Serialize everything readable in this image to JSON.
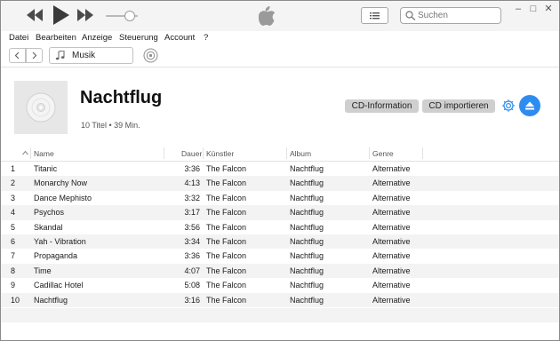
{
  "search": {
    "placeholder": "Suchen"
  },
  "menu": [
    "Datei",
    "Bearbeiten",
    "Anzeige",
    "Steuerung",
    "Account",
    "?"
  ],
  "nav": {
    "media_type": "Musik"
  },
  "album": {
    "title": "Nachtflug",
    "subtitle": "10 Titel • 39 Min.",
    "cd_info_label": "CD-Information",
    "import_label": "CD importieren"
  },
  "table": {
    "headers": {
      "name": "Name",
      "duration": "Dauer",
      "artist": "Künstler",
      "album": "Album",
      "genre": "Genre"
    },
    "rows": [
      {
        "num": "1",
        "name": "Titanic",
        "duration": "3:36",
        "artist": "The Falcon",
        "album": "Nachtflug",
        "genre": "Alternative"
      },
      {
        "num": "2",
        "name": "Monarchy Now",
        "duration": "4:13",
        "artist": "The Falcon",
        "album": "Nachtflug",
        "genre": "Alternative"
      },
      {
        "num": "3",
        "name": "Dance Mephisto",
        "duration": "3:32",
        "artist": "The Falcon",
        "album": "Nachtflug",
        "genre": "Alternative"
      },
      {
        "num": "4",
        "name": "Psychos",
        "duration": "3:17",
        "artist": "The Falcon",
        "album": "Nachtflug",
        "genre": "Alternative"
      },
      {
        "num": "5",
        "name": "Skandal",
        "duration": "3:56",
        "artist": "The Falcon",
        "album": "Nachtflug",
        "genre": "Alternative"
      },
      {
        "num": "6",
        "name": "Yah - Vibration",
        "duration": "3:34",
        "artist": "The Falcon",
        "album": "Nachtflug",
        "genre": "Alternative"
      },
      {
        "num": "7",
        "name": "Propaganda",
        "duration": "3:36",
        "artist": "The Falcon",
        "album": "Nachtflug",
        "genre": "Alternative"
      },
      {
        "num": "8",
        "name": "Time",
        "duration": "4:07",
        "artist": "The Falcon",
        "album": "Nachtflug",
        "genre": "Alternative"
      },
      {
        "num": "9",
        "name": "Cadillac Hotel",
        "duration": "5:08",
        "artist": "The Falcon",
        "album": "Nachtflug",
        "genre": "Alternative"
      },
      {
        "num": "10",
        "name": "Nachtflug",
        "duration": "3:16",
        "artist": "The Falcon",
        "album": "Nachtflug",
        "genre": "Alternative"
      }
    ]
  },
  "playback": {
    "volume_level": 0.75
  },
  "colors": {
    "accent": "#2e8cf0",
    "button_gray": "#cfcfcf",
    "row_alt": "#f3f3f3"
  },
  "icons": [
    "previous-track-icon",
    "play-icon",
    "next-track-icon",
    "apple-logo-icon",
    "list-view-icon",
    "search-icon",
    "minimize-icon",
    "maximize-icon",
    "close-icon",
    "back-arrow-icon",
    "forward-arrow-icon",
    "music-note-icon",
    "radio-icon",
    "cd-icon",
    "gear-icon",
    "eject-icon",
    "sort-arrow-icon"
  ]
}
